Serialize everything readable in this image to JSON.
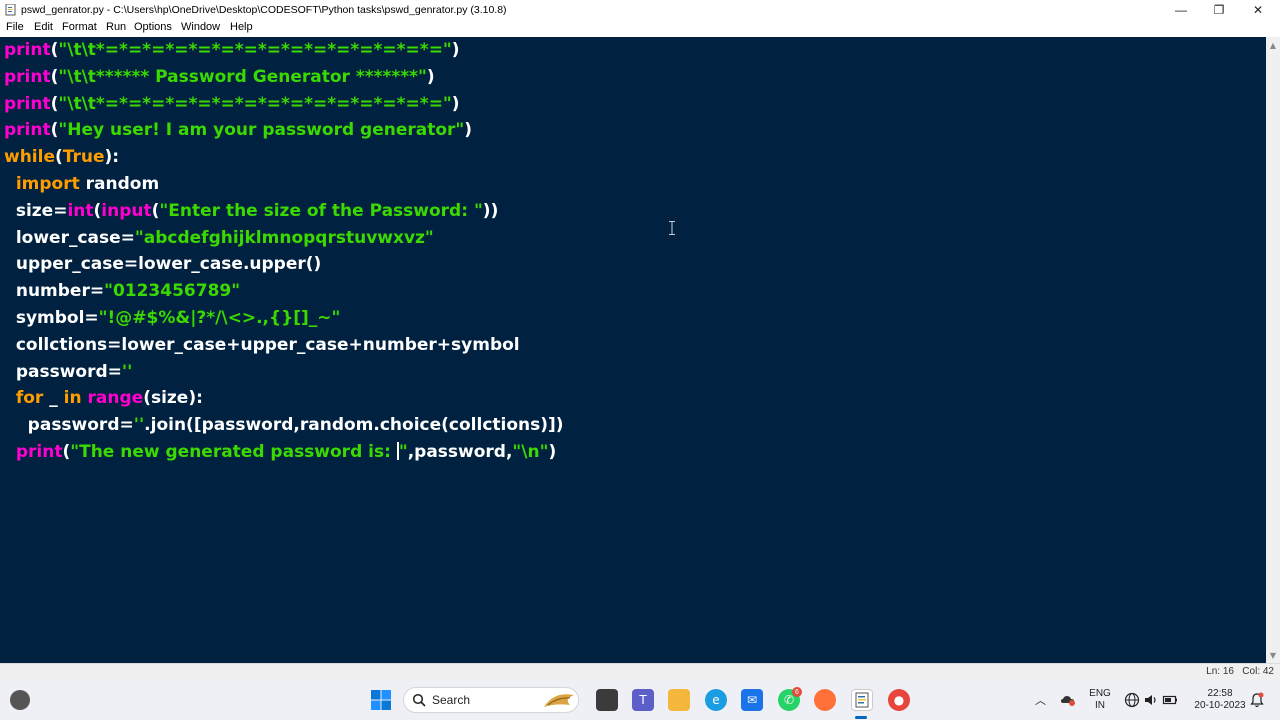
{
  "window": {
    "title": "pswd_genrator.py - C:\\Users\\hp\\OneDrive\\Desktop\\CODESOFT\\Python tasks\\pswd_genrator.py (3.10.8)",
    "minimize_glyph": "—",
    "maximize_glyph": "❐",
    "close_glyph": "✕"
  },
  "menu": {
    "file": "File",
    "edit": "Edit",
    "format": "Format",
    "run": "Run",
    "options": "Options",
    "window": "Window",
    "help": "Help"
  },
  "code": [
    [
      {
        "t": "bi",
        "v": "print"
      },
      {
        "t": "pl",
        "v": "("
      },
      {
        "t": "st",
        "v": "\"\\t\\t*=*=*=*=*=*=*=*=*=*=*=*=*=*=*=\""
      },
      {
        "t": "pl",
        "v": ")"
      }
    ],
    [
      {
        "t": "bi",
        "v": "print"
      },
      {
        "t": "pl",
        "v": "("
      },
      {
        "t": "st",
        "v": "\"\\t\\t****** Password Generator *******\""
      },
      {
        "t": "pl",
        "v": ")"
      }
    ],
    [
      {
        "t": "bi",
        "v": "print"
      },
      {
        "t": "pl",
        "v": "("
      },
      {
        "t": "st",
        "v": "\"\\t\\t*=*=*=*=*=*=*=*=*=*=*=*=*=*=*=\""
      },
      {
        "t": "pl",
        "v": ")"
      }
    ],
    [
      {
        "t": "bi",
        "v": "print"
      },
      {
        "t": "pl",
        "v": "("
      },
      {
        "t": "st",
        "v": "\"Hey user! I am your password generator\""
      },
      {
        "t": "pl",
        "v": ")"
      }
    ],
    [
      {
        "t": "kw",
        "v": "while"
      },
      {
        "t": "pl",
        "v": "("
      },
      {
        "t": "kw",
        "v": "True"
      },
      {
        "t": "pl",
        "v": "):"
      }
    ],
    [
      {
        "t": "pl",
        "v": "  "
      },
      {
        "t": "kw",
        "v": "import"
      },
      {
        "t": "pl",
        "v": " random"
      }
    ],
    [
      {
        "t": "pl",
        "v": "  size="
      },
      {
        "t": "bi",
        "v": "int"
      },
      {
        "t": "pl",
        "v": "("
      },
      {
        "t": "bi",
        "v": "input"
      },
      {
        "t": "pl",
        "v": "("
      },
      {
        "t": "st",
        "v": "\"Enter the size of the Password: \""
      },
      {
        "t": "pl",
        "v": "))"
      }
    ],
    [
      {
        "t": "pl",
        "v": "  lower_case="
      },
      {
        "t": "st",
        "v": "\"abcdefghijklmnopqrstuvwxvz\""
      }
    ],
    [
      {
        "t": "pl",
        "v": "  upper_case=lower_case.upper()"
      }
    ],
    [
      {
        "t": "pl",
        "v": "  number="
      },
      {
        "t": "st",
        "v": "\"0123456789\""
      }
    ],
    [
      {
        "t": "pl",
        "v": "  symbol="
      },
      {
        "t": "st",
        "v": "\"!@#$%&|?*/\\<>.,{}[]_~\""
      }
    ],
    [
      {
        "t": "pl",
        "v": "  collctions=lower_case+upper_case+number+symbol"
      }
    ],
    [
      {
        "t": "pl",
        "v": "  password="
      },
      {
        "t": "st",
        "v": "''"
      }
    ],
    [
      {
        "t": "pl",
        "v": "  "
      },
      {
        "t": "kw",
        "v": "for"
      },
      {
        "t": "pl",
        "v": " _ "
      },
      {
        "t": "kw",
        "v": "in"
      },
      {
        "t": "pl",
        "v": " "
      },
      {
        "t": "bi",
        "v": "range"
      },
      {
        "t": "pl",
        "v": "(size):"
      }
    ],
    [
      {
        "t": "pl",
        "v": "    password="
      },
      {
        "t": "st",
        "v": "''"
      },
      {
        "t": "pl",
        "v": ".join([password,random.choice(collctions)])"
      }
    ],
    [
      {
        "t": "pl",
        "v": "  "
      },
      {
        "t": "bi",
        "v": "print"
      },
      {
        "t": "pl",
        "v": "("
      },
      {
        "t": "st",
        "v": "\"The new generated password is: "
      },
      {
        "t": "caret",
        "v": ""
      },
      {
        "t": "st",
        "v": "\""
      },
      {
        "t": "pl",
        "v": ",password,"
      },
      {
        "t": "st",
        "v": "\"\\n\""
      },
      {
        "t": "pl",
        "v": ")"
      }
    ]
  ],
  "status": {
    "position": "Ln: 16   Col: 42"
  },
  "taskbar": {
    "search_label": "Search",
    "teams_badge": "6",
    "lang_top": "ENG",
    "lang_bottom": "IN",
    "time": "22:58",
    "date": "20-10-2023",
    "icons": [
      "windows-start-icon",
      "search-icon",
      "task-view-icon",
      "teams-icon",
      "file-explorer-icon",
      "edge-icon",
      "mail-icon",
      "whatsapp-icon",
      "firefox-icon",
      "idle-editor-icon",
      "chrome-icon"
    ]
  },
  "colors": {
    "editor_bg": "#002240",
    "keyword": "#ff9d00",
    "builtin": "#ff00d0",
    "string": "#3ad900",
    "plain": "#ffffff"
  }
}
